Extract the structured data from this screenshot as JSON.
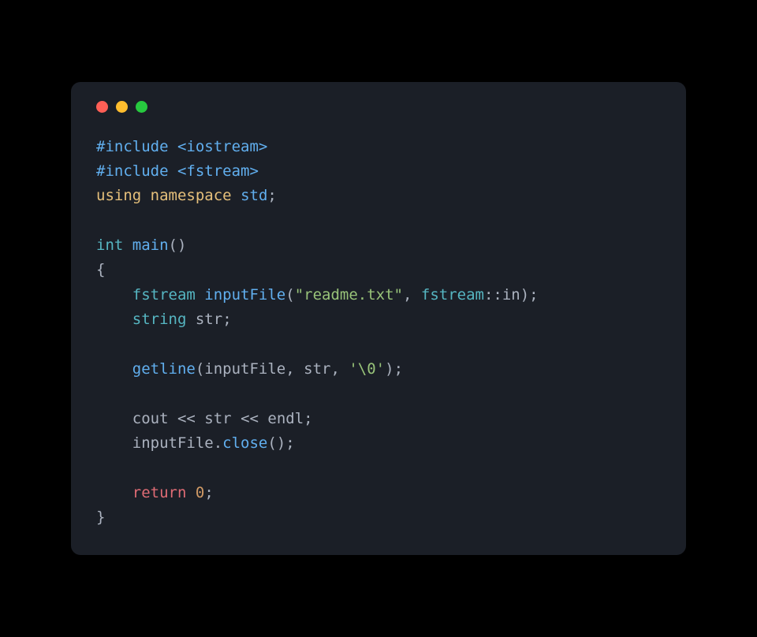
{
  "window": {
    "controls": [
      "close",
      "minimize",
      "maximize"
    ]
  },
  "code": {
    "line1_include": "#include ",
    "line1_header": "<iostream>",
    "line2_include": "#include ",
    "line2_header": "<fstream>",
    "line3_using": "using",
    "line3_namespace": "namespace",
    "line3_std": "std",
    "line3_semi": ";",
    "line5_int": "int",
    "line5_main": "main",
    "line5_parens": "()",
    "line6_brace": "{",
    "line7_indent": "    ",
    "line7_fstream": "fstream",
    "line7_inputFile": "inputFile",
    "line7_open": "(",
    "line7_string": "\"readme.txt\"",
    "line7_comma": ", ",
    "line7_fstream2": "fstream",
    "line7_scope": "::",
    "line7_in": "in",
    "line7_close": ");",
    "line8_indent": "    ",
    "line8_string_t": "string",
    "line8_str": "str",
    "line8_semi": ";",
    "line10_indent": "    ",
    "line10_getline": "getline",
    "line10_open": "(",
    "line10_inputFile": "inputFile",
    "line10_comma1": ", ",
    "line10_str": "str",
    "line10_comma2": ", ",
    "line10_char": "'\\0'",
    "line10_close": ");",
    "line12_indent": "    ",
    "line12_cout": "cout",
    "line12_op1": " << ",
    "line12_str": "str",
    "line12_op2": " << ",
    "line12_endl": "endl",
    "line12_semi": ";",
    "line13_indent": "    ",
    "line13_inputFile": "inputFile",
    "line13_dot": ".",
    "line13_close": "close",
    "line13_parens": "();",
    "line15_indent": "    ",
    "line15_return": "return",
    "line15_sp": " ",
    "line15_zero": "0",
    "line15_semi": ";",
    "line16_brace": "}"
  }
}
